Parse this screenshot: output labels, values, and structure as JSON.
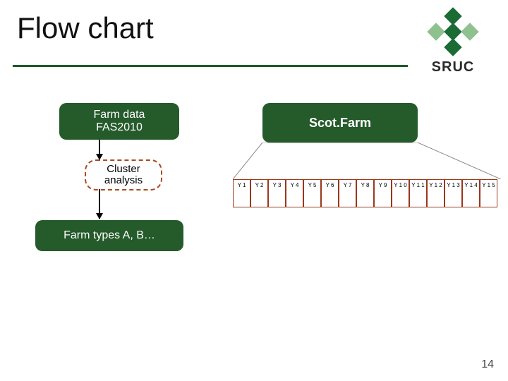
{
  "title": "Flow chart",
  "logo": {
    "text": "SRUC"
  },
  "boxes": {
    "farm_data": "Farm data\nFAS2010",
    "scotfarm": "Scot.Farm",
    "farm_types": "Farm types A, B…"
  },
  "cluster": "Cluster\nanalysis",
  "years": [
    "Y 1",
    "Y 2",
    "Y 3",
    "Y 4",
    "Y 5",
    "Y 6",
    "Y 7",
    "Y 8",
    "Y 9",
    "Y 1 0",
    "Y 1 1",
    "Y 1 2",
    "Y 1 3",
    "Y 1 4",
    "Y 1 5"
  ],
  "page_number": "14",
  "colors": {
    "green_dark": "#255a2b",
    "green_line": "#1f5a2a",
    "orange": "#9a371b"
  }
}
